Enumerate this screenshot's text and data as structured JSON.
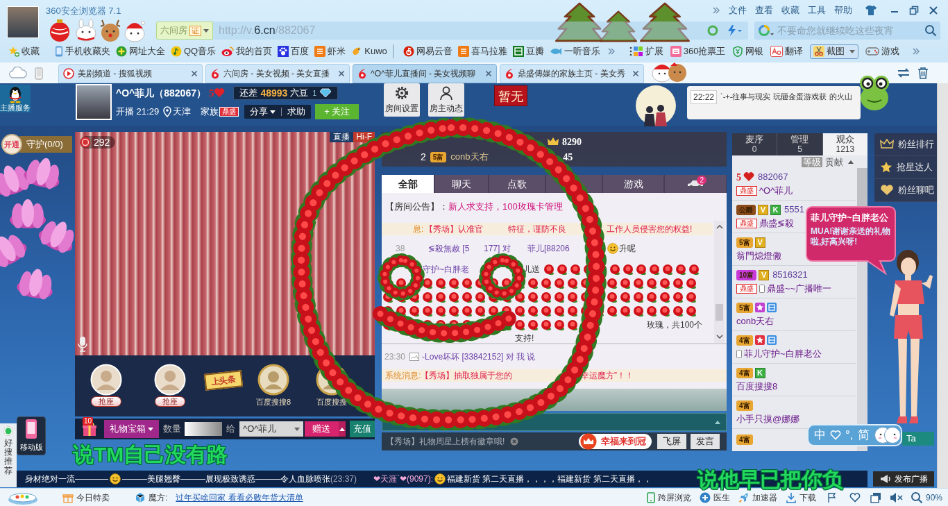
{
  "browser": {
    "title": "360安全浏览器 7.1",
    "menu": [
      "文件",
      "查看",
      "收藏",
      "工具",
      "帮助"
    ],
    "address": {
      "site": "六间房",
      "cert": "证",
      "url_prefix": "http://v.",
      "url_domain": "6.cn",
      "url_path": "/882067"
    },
    "search": {
      "placeholder": "不要命您就继续吃这些夜宵"
    },
    "bookmarks": [
      {
        "label": "收藏",
        "kind": "star"
      },
      {
        "label": "手机收藏夹",
        "kind": "phone"
      },
      {
        "label": "网址大全",
        "kind": "plus"
      },
      {
        "label": "QQ音乐",
        "kind": "note"
      },
      {
        "label": "我的首页",
        "kind": "eye"
      },
      {
        "label": "百度",
        "kind": "paw"
      },
      {
        "label": "虾米",
        "kind": "tile"
      },
      {
        "label": "Kuwo",
        "kind": "bird",
        "divider": true
      },
      {
        "label": "网易云音",
        "kind": "disc"
      },
      {
        "label": "喜马拉雅",
        "kind": "tile"
      },
      {
        "label": "豆瓣",
        "kind": "box"
      },
      {
        "label": "一听音乐",
        "kind": "fish"
      }
    ],
    "extensions": [
      {
        "label": "扩展",
        "kind": "apps"
      },
      {
        "label": "360抢票王",
        "kind": "ticket"
      },
      {
        "label": "网银",
        "kind": "shield"
      },
      {
        "label": "翻译",
        "kind": "translate"
      },
      {
        "label": "截图",
        "kind": "scissors"
      },
      {
        "label": "游戏",
        "kind": "gamepad"
      }
    ],
    "tabs": [
      {
        "label": "美剧频道 - 搜狐视频",
        "kind": "sohu",
        "selected": false
      },
      {
        "label": "六间房 - 美女视频 - 美女直播",
        "kind": "six",
        "selected": false
      },
      {
        "label": "^O^菲儿直播间 - 美女视频聊",
        "kind": "six",
        "selected": true
      },
      {
        "label": "鼎盛傳媒的家族主页 - 美女秀",
        "kind": "six",
        "selected": false
      }
    ]
  },
  "room": {
    "service": "主播服务",
    "anchor": {
      "name": "^O^菲儿（882067）",
      "level": "5",
      "gap_label": "还差",
      "gap_value": "48993",
      "gap_unit": "六豆",
      "diamond": "1",
      "start": "开播 21:29",
      "city": "天津",
      "family_label": "家族",
      "family_badge": "鼎盛",
      "share": "分享",
      "help": "求助",
      "follow": "+ 关注"
    },
    "room_buttons": [
      {
        "label": "房间设置",
        "kind": "gear"
      },
      {
        "label": "房主动态",
        "kind": "person"
      }
    ],
    "rank_plaque": "暂无",
    "news": {
      "time": "22:22",
      "text": "`-+-往事与现实 玩砸金蛋游戏获",
      "tail": "的火山"
    }
  },
  "guard": {
    "open": "开通",
    "label": "守护(0/0)"
  },
  "video": {
    "wealth": "292",
    "live": "直播",
    "quality": "Hi-F"
  },
  "seats": [
    {
      "kind": "empty",
      "label": "抢座"
    },
    {
      "kind": "empty",
      "label": "抢座"
    },
    {
      "kind": "headline",
      "label": "上头条"
    },
    {
      "kind": "user",
      "label": "百度搜搜8"
    },
    {
      "kind": "user",
      "label": "百度搜搜"
    }
  ],
  "gift_bar": {
    "badge": "10",
    "box": "礼物宝箱",
    "qty_label": "数量",
    "to_label": "给",
    "recipient": "^O^菲儿",
    "send": "赠送",
    "recharge": "充值"
  },
  "ranking": [
    {
      "value": "8290"
    },
    {
      "rank": "2",
      "badge": "5富",
      "name": "conb天右",
      "value": "45"
    }
  ],
  "chat": {
    "tabs": [
      {
        "kind": "text",
        "label": "全部",
        "selected": true
      },
      {
        "kind": "text",
        "label": "聊天",
        "selected": false
      },
      {
        "kind": "text",
        "label": "点歌",
        "selected": false
      },
      {
        "kind": "covered",
        "selected": false
      },
      {
        "kind": "text",
        "label": "游戏",
        "selected": false
      },
      {
        "kind": "car",
        "badge": "2",
        "selected": false
      }
    ],
    "notice": {
      "label": "【房间公告】：",
      "text": "新人求支持，100玫瑰卡管理"
    },
    "messages": [
      {
        "kind": "system",
        "parts": [
          {
            "kind": "label",
            "text": "息:"
          },
          {
            "kind": "alert",
            "text": "【秀场】认准官"
          },
          {
            "kind": "alert",
            "text": "特征，谨防不良"
          },
          {
            "kind": "alert",
            "text": "工作人员侵害您的权益!"
          }
        ]
      },
      {
        "kind": "chat",
        "parts": [
          {
            "kind": "time",
            "text": "38"
          },
          {
            "kind": "name",
            "text": "≶殺無赦 [5"
          },
          {
            "kind": "name",
            "text": "177] 对"
          },
          {
            "kind": "name",
            "text": "菲儿[88206"
          },
          {
            "kind": "emoji"
          },
          {
            "kind": "plain",
            "text": "升呢"
          }
        ]
      },
      {
        "kind": "gift",
        "parts": [
          {
            "kind": "name",
            "text": "守护~白胖老"
          },
          {
            "kind": "plain",
            "text": "儿送"
          },
          {
            "kind": "roses"
          },
          {
            "kind": "plain",
            "text": "玫瑰，共100个"
          }
        ]
      },
      {
        "kind": "chat",
        "parts": [
          {
            "kind": "plain",
            "text": "支持!"
          }
        ]
      }
    ],
    "private": [
      {
        "kind": "chat",
        "time": "23:30",
        "text": "-Love坏坏 [33842152] 对 我 说"
      },
      {
        "kind": "system",
        "label": "系统消息:",
        "text": "【秀场】抽取独属于您的",
        "tail": "幸运魔方”！！"
      }
    ],
    "tip": "【秀场】礼物周星上榜有徽章哦!",
    "buttons": [
      {
        "kind": "crown",
        "label": "幸福来到冠"
      },
      {
        "kind": "plain",
        "label": "飞屏"
      },
      {
        "kind": "plain",
        "label": "发言"
      }
    ]
  },
  "audience": {
    "tabs": [
      {
        "label": "麦序",
        "count": "0",
        "selected": false
      },
      {
        "label": "管理",
        "count": "5",
        "selected": false
      },
      {
        "label": "观众",
        "count": "1213",
        "selected": true
      }
    ],
    "sort": [
      {
        "label": "等级",
        "selected": true
      },
      {
        "label": "贡献",
        "selected": false
      }
    ],
    "users": [
      {
        "badges": [
          {
            "kind": "level",
            "text": "5"
          }
        ],
        "id": "882067",
        "family": "鼎盛",
        "name": "^O^菲儿"
      },
      {
        "badges": [
          {
            "kind": "wealth",
            "text": "公爵",
            "color": "#8a4a1a"
          },
          {
            "kind": "vip",
            "text": "V"
          },
          {
            "kind": "k",
            "text": "K"
          }
        ],
        "id": "5551",
        "family": "鼎盛",
        "name": "鼎盛≶殺"
      },
      {
        "badges": [
          {
            "kind": "wealth",
            "text": "5富",
            "color": "#e8a530"
          },
          {
            "kind": "vip",
            "text": "V"
          }
        ],
        "name": "翁門熄燈僘"
      },
      {
        "badges": [
          {
            "kind": "wealth",
            "text": "10富",
            "color": "#c83ad8"
          },
          {
            "kind": "vip",
            "text": "V"
          }
        ],
        "id": "8516321",
        "family": "鼎盛",
        "phone": true,
        "name": "鼎盛~~广播唯一"
      },
      {
        "badges": [
          {
            "kind": "wealth",
            "text": "5富",
            "color": "#e8a530"
          },
          {
            "kind": "star",
            "color": "#c040d0"
          },
          {
            "kind": "official"
          }
        ],
        "name": "conb天右"
      },
      {
        "badges": [
          {
            "kind": "wealth",
            "text": "4富",
            "color": "#e8a530"
          },
          {
            "kind": "star",
            "color": "#e03040"
          },
          {
            "kind": "official"
          }
        ],
        "phone": true,
        "name": "菲儿守护~白胖老公"
      },
      {
        "badges": [
          {
            "kind": "wealth",
            "text": "4富",
            "color": "#e8a530"
          },
          {
            "kind": "k",
            "text": "K"
          }
        ],
        "name": "百度搜搜8"
      },
      {
        "badges": [
          {
            "kind": "wealth",
            "text": "4富",
            "color": "#e8a530"
          }
        ],
        "name": "小手只摸@娜娜"
      },
      {
        "badges": [
          {
            "kind": "wealth",
            "text": "4富",
            "color": "#e8a530"
          }
        ]
      }
    ]
  },
  "fan_buttons": [
    {
      "kind": "crown",
      "label": "粉丝排行"
    },
    {
      "kind": "star",
      "label": "抢星达人"
    },
    {
      "kind": "heart",
      "label": "粉丝聊吧"
    }
  ],
  "bubble": {
    "title": "菲儿守护~白胖老公",
    "text": "MUA!谢谢亲送的礼物啦,好高兴呀!"
  },
  "ime": {
    "mode": "中",
    "punct": "°,",
    "script": "简",
    "ta": "Ta"
  },
  "side": {
    "mobile": "移动版",
    "haosou": "好搜推荐"
  },
  "danmaku": [
    "说TM自己没有路",
    "说他早已把你负"
  ],
  "marquee": {
    "items": [
      {
        "kind": "text",
        "text": "身材绝对一流————"
      },
      {
        "kind": "emoji"
      },
      {
        "kind": "text",
        "text": "———美腿翘臀———展现极致诱惑———令人血脉喷张"
      },
      {
        "kind": "time",
        "text": "(23:37)"
      },
      {
        "kind": "user",
        "text": "❤天涯`❤(9097):"
      },
      {
        "kind": "emoji"
      },
      {
        "kind": "text",
        "text": "福建新货 第二天直播，，，，福建新货 第二天直播，，"
      }
    ],
    "publish": "发布广播"
  },
  "status": {
    "left": [
      {
        "kind": "gift",
        "label": "今日特卖"
      },
      {
        "kind": "cube",
        "label": "魔方:"
      }
    ],
    "link": "过年买啥回家 看看必败年货大清单",
    "right": [
      {
        "kind": "phone",
        "label": "跨屏浏览"
      },
      {
        "kind": "cross",
        "label": "医生"
      },
      {
        "kind": "rocket",
        "label": "加速器"
      },
      {
        "kind": "download",
        "label": "下载"
      }
    ],
    "zoom": "90%"
  }
}
